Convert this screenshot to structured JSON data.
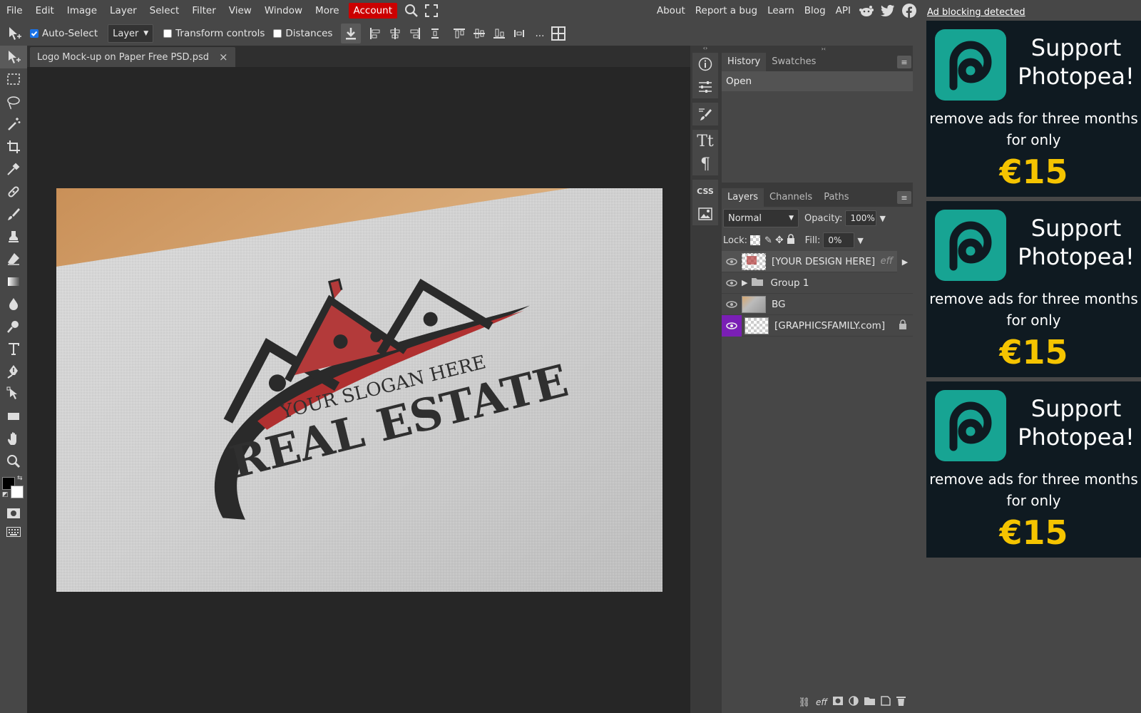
{
  "menu": {
    "items": [
      "File",
      "Edit",
      "Image",
      "Layer",
      "Select",
      "Filter",
      "View",
      "Window",
      "More"
    ],
    "account": "Account",
    "right": [
      "About",
      "Report a bug",
      "Learn",
      "Blog",
      "API"
    ]
  },
  "options": {
    "auto_select": "Auto-Select",
    "auto_select_checked": true,
    "select_mode": "Layer",
    "transform_controls": "Transform controls",
    "distances": "Distances",
    "more": "..."
  },
  "document": {
    "tab_title": "Logo Mock-up on Paper Free PSD.psd",
    "close": "×"
  },
  "artwork": {
    "slogan": "YOUR SLOGAN HERE",
    "headline": "REAL ESTATE"
  },
  "iconstrip": {
    "css_label": "CSS"
  },
  "history": {
    "tabs": [
      "History",
      "Swatches"
    ],
    "entries": [
      "Open"
    ]
  },
  "layers": {
    "tabs": [
      "Layers",
      "Channels",
      "Paths"
    ],
    "blend_mode": "Normal",
    "opacity_label": "Opacity:",
    "opacity_value": "100%",
    "lock_label": "Lock:",
    "fill_label": "Fill:",
    "fill_value": "0%",
    "rows": [
      {
        "name": "[YOUR DESIGN HERE]",
        "badge": "eff"
      },
      {
        "name": "Group 1"
      },
      {
        "name": "BG"
      },
      {
        "name": "[GRAPHICSFAMILY.com]"
      }
    ]
  },
  "ads": {
    "notice": "Ad blocking detected",
    "title": "Support Photopea!",
    "subtitle": "remove ads for three months for only",
    "price": "€15",
    "brand_color": "#17a493",
    "price_color": "#f5c400"
  },
  "colors": {
    "account_bg": "#cc0000",
    "selected_layer_eye": "#7a1fb5"
  }
}
